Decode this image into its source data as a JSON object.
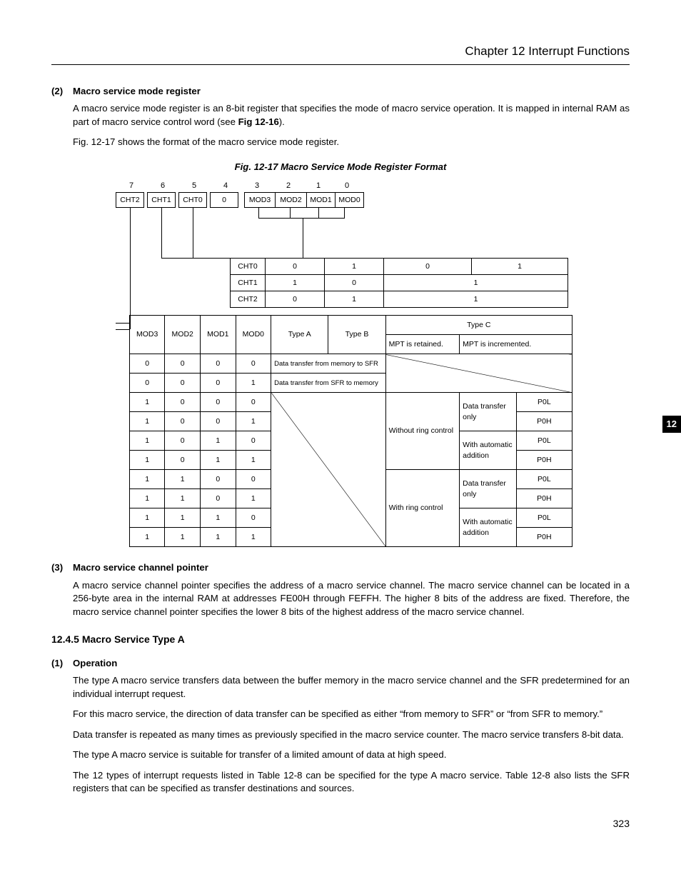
{
  "chapter_header": "Chapter 12   Interrupt Functions",
  "side_tab": "12",
  "page_number": "323",
  "sec2": {
    "num": "(2)",
    "title": "Macro service mode register",
    "p1a": "A macro service mode register is an 8-bit register that specifies the mode of macro service operation.  It is mapped in internal RAM as part of macro service control word (see ",
    "p1b": "Fig 12-16",
    "p1c": ").",
    "p2": "Fig. 12-17 shows the format of the macro service mode register."
  },
  "fig": {
    "caption": "Fig. 12-17  Macro Service Mode Register Format",
    "bitnums": [
      "7",
      "6",
      "5",
      "4",
      "3",
      "2",
      "1",
      "0"
    ],
    "bits": [
      "CHT2",
      "CHT1",
      "CHT0",
      "0",
      "MOD3",
      "MOD2",
      "MOD1",
      "MOD0"
    ],
    "cht": {
      "rows": [
        {
          "lbl": "CHT0",
          "a": "0",
          "b": "1",
          "c": "0",
          "d": "1"
        },
        {
          "lbl": "CHT1",
          "a": "1",
          "b": "0",
          "c": "1",
          "d": ""
        },
        {
          "lbl": "CHT2",
          "a": "0",
          "b": "1",
          "c": "1",
          "d": ""
        }
      ]
    },
    "mod": {
      "hdr": [
        "MOD3",
        "MOD2",
        "MOD1",
        "MOD0"
      ],
      "typeA": "Type A",
      "typeB": "Type B",
      "typeC": "Type C",
      "mptR": "MPT is retained.",
      "mptI": "MPT is incremented.",
      "r1desc": "Data transfer from memory to SFR",
      "r2desc": "Data transfer from SFR to memory",
      "withoutRC": "Without ring control",
      "withRC": "With ring control",
      "dto": "Data transfer only",
      "waa": "With automatic addition",
      "p0l": "P0L",
      "p0h": "P0H",
      "rows": [
        [
          "0",
          "0",
          "0",
          "0"
        ],
        [
          "0",
          "0",
          "0",
          "1"
        ],
        [
          "1",
          "0",
          "0",
          "0"
        ],
        [
          "1",
          "0",
          "0",
          "1"
        ],
        [
          "1",
          "0",
          "1",
          "0"
        ],
        [
          "1",
          "0",
          "1",
          "1"
        ],
        [
          "1",
          "1",
          "0",
          "0"
        ],
        [
          "1",
          "1",
          "0",
          "1"
        ],
        [
          "1",
          "1",
          "1",
          "0"
        ],
        [
          "1",
          "1",
          "1",
          "1"
        ]
      ]
    }
  },
  "sec3": {
    "num": "(3)",
    "title": "Macro service channel pointer",
    "p1": "A macro service channel pointer specifies the address of a macro service channel.  The macro service channel can be located in a 256-byte area in the internal RAM at addresses FE00H through FEFFH.  The higher 8 bits of the address are fixed.  Therefore, the macro service channel pointer specifies the lower 8 bits of the highest address of the macro service channel."
  },
  "sec1245": {
    "title": "12.4.5  Macro Service Type A",
    "op_num": "(1)",
    "op_title": "Operation",
    "p1": "The type A macro service transfers data between the buffer memory in the macro service channel and the SFR predetermined for an individual interrupt request.",
    "p2": "For this macro service, the direction of data transfer can be specified as either “from memory to SFR” or “from SFR to memory.”",
    "p3": "Data transfer is repeated as many times as previously specified in the macro service counter.  The macro service transfers 8-bit data.",
    "p4": "The type A macro service is suitable for transfer of a limited amount of data at high speed.",
    "p5": "The 12 types of interrupt requests listed in Table 12-8 can be specified for the type A macro service.  Table 12-8 also lists the SFR registers that can be specified as transfer destinations and sources."
  }
}
